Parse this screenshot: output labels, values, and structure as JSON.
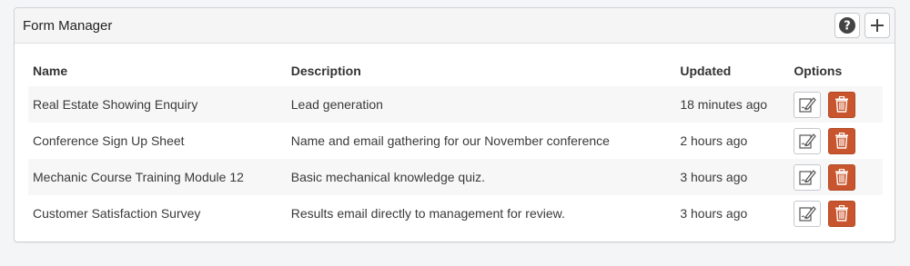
{
  "panel": {
    "title": "Form Manager",
    "actions": [
      {
        "name": "help",
        "icon": "question-circle-icon"
      },
      {
        "name": "add",
        "icon": "plus-icon"
      }
    ]
  },
  "table": {
    "headers": {
      "name": "Name",
      "description": "Description",
      "updated": "Updated",
      "options": "Options"
    },
    "rows": [
      {
        "name": "Real Estate Showing Enquiry",
        "description": "Lead generation",
        "updated": "18 minutes ago"
      },
      {
        "name": "Conference Sign Up Sheet",
        "description": "Name and email gathering for our November conference",
        "updated": "2 hours ago"
      },
      {
        "name": "Mechanic Course Training Module 12",
        "description": "Basic mechanical knowledge quiz.",
        "updated": "3 hours ago"
      },
      {
        "name": "Customer Satisfaction Survey",
        "description": "Results email directly to management for review.",
        "updated": "3 hours ago"
      }
    ],
    "row_actions": [
      {
        "name": "edit",
        "icon": "edit-icon"
      },
      {
        "name": "delete",
        "icon": "trash-icon"
      }
    ]
  },
  "colors": {
    "delete_button": "#c8552d",
    "panel_header_bg": "#f5f5f5",
    "page_bg": "#f3f5f7"
  }
}
